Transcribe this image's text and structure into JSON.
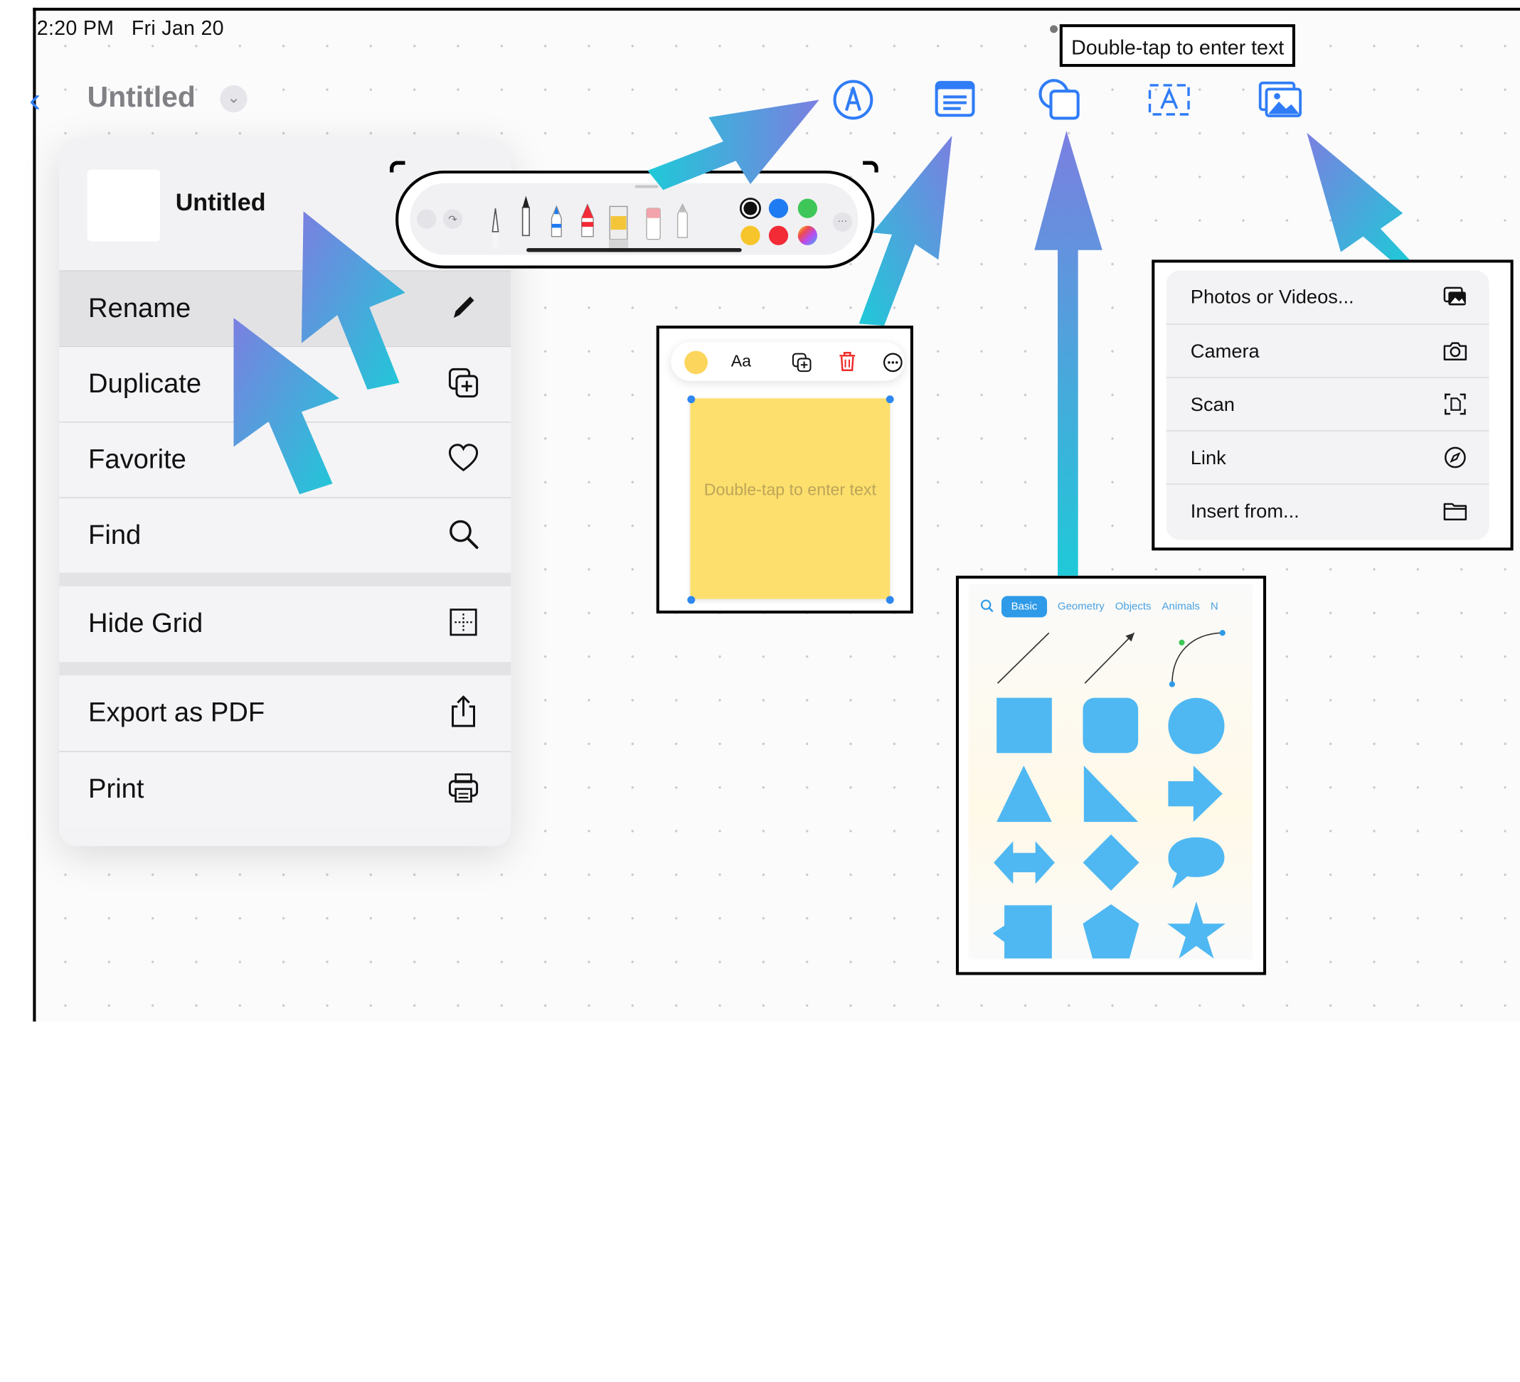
{
  "status_bar": {
    "time": "2:20 PM",
    "date": "Fri Jan 20"
  },
  "title_bar": {
    "back_icon": "chevron-left-icon",
    "document_title": "Untitled",
    "title_menu_icon": "chevron-down-icon"
  },
  "toolbar": {
    "icons": [
      "markup-pen-icon",
      "sticky-note-icon",
      "shapes-icon",
      "text-box-icon",
      "insert-media-icon"
    ],
    "tooltip": "Double-tap to enter text"
  },
  "document_menu": {
    "header_title": "Untitled",
    "items": [
      {
        "label": "Rename",
        "icon": "pencil-icon"
      },
      {
        "label": "Duplicate",
        "icon": "duplicate-icon"
      },
      {
        "label": "Favorite",
        "icon": "heart-icon"
      },
      {
        "label": "Find",
        "icon": "magnifying-glass-icon"
      },
      {
        "label": "Hide Grid",
        "icon": "grid-icon"
      },
      {
        "label": "Export as PDF",
        "icon": "share-icon"
      },
      {
        "label": "Print",
        "icon": "printer-icon"
      }
    ]
  },
  "drawing_toolbar": {
    "tools": [
      "undo-icon",
      "redo-icon",
      "monoline-pen-icon",
      "pen-icon",
      "marker-blue-icon",
      "marker-red-icon",
      "highlighter-icon",
      "eraser-icon",
      "pencil-tool-icon"
    ],
    "colors": [
      "#111111",
      "#1f7bf2",
      "#3ec758",
      "#f6c52c",
      "#f22b36",
      "rainbow"
    ],
    "more_icon": "more-icon"
  },
  "sticky_note": {
    "toolbar_font_label": "Aa",
    "toolbar_icons": [
      "color-swatch-icon",
      "duplicate-icon",
      "trash-icon",
      "more-icon"
    ],
    "note_text": "Double-tap to enter text",
    "note_color": "#fddf6d"
  },
  "shapes_panel": {
    "search_icon": "search-icon",
    "tabs": [
      "Basic",
      "Geometry",
      "Objects",
      "Animals",
      "N"
    ],
    "selected_tab": "Basic",
    "shapes": [
      "line-shape",
      "arrow-line-shape",
      "curve-shape",
      "square-shape",
      "rounded-square-shape",
      "circle-shape",
      "triangle-shape",
      "right-triangle-shape",
      "arrow-right-shape",
      "double-arrow-shape",
      "diamond-shape",
      "speech-bubble-shape",
      "callout-square-shape",
      "pentagon-shape",
      "star-shape"
    ],
    "accent": "#4fb8f2"
  },
  "insert_menu": {
    "items": [
      {
        "label": "Photos or Videos...",
        "icon": "photos-icon"
      },
      {
        "label": "Camera",
        "icon": "camera-icon"
      },
      {
        "label": "Scan",
        "icon": "scan-icon"
      },
      {
        "label": "Link",
        "icon": "compass-link-icon"
      },
      {
        "label": "Insert from...",
        "icon": "folder-icon"
      }
    ]
  },
  "annotation_arrows": {
    "gradient": [
      "#7b7fe0",
      "#1fc9d8"
    ]
  }
}
